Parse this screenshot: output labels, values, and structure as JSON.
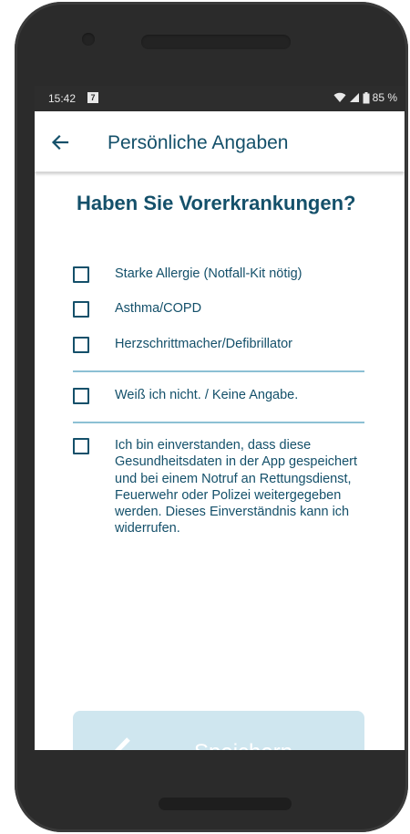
{
  "status_bar": {
    "time": "15:42",
    "notification_badge": "7",
    "battery": "85 %"
  },
  "app_bar": {
    "back_icon": "arrow-left-icon",
    "title": "Persönliche Angaben"
  },
  "question": {
    "title": "Haben Sie Vorerkrankungen?"
  },
  "options": [
    {
      "label": "Starke Allergie (Notfall-Kit nötig)",
      "checked": false
    },
    {
      "label": "Asthma/COPD",
      "checked": false
    },
    {
      "label": "Herzschrittmacher/Defibrillator",
      "checked": false
    },
    {
      "label": "Weiß ich nicht. / Keine Angabe.",
      "checked": false
    }
  ],
  "consent": {
    "label": "Ich bin einverstanden, dass diese Gesundheitsdaten in der App gespeichert und bei einem Notruf an Rettungsdienst, Feuerwehr oder Polizei weitergegeben werden. Dieses Einverständnis kann ich widerrufen.",
    "checked": false
  },
  "save_button": {
    "label": "Speichern",
    "icon": "checkmark-icon",
    "enabled": false
  },
  "colors": {
    "primary": "#14506a",
    "divider": "#8cc0d4",
    "button_disabled_bg": "#cfe6ef",
    "frame": "#2b2b2b",
    "status_bar": "#2d2d2d"
  }
}
